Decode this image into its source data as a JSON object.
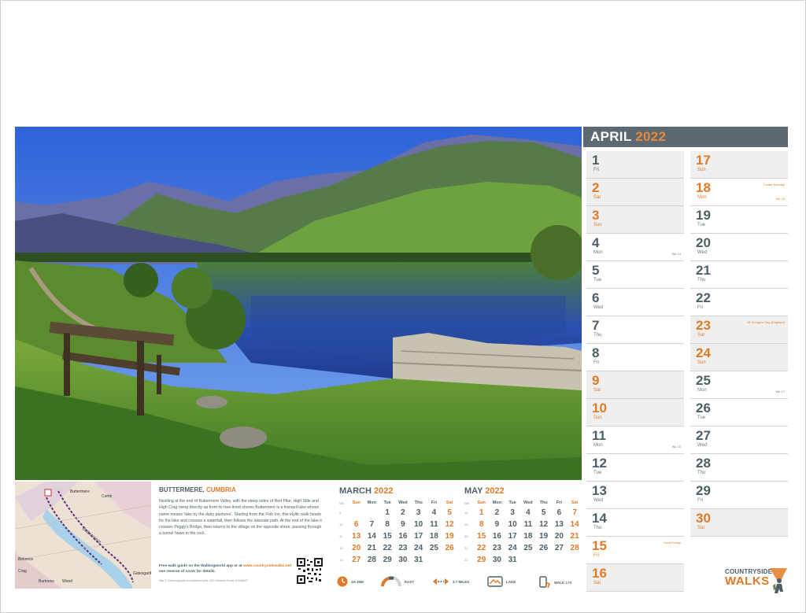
{
  "calendar": {
    "month": "APRIL",
    "year": "2022",
    "left_days": [
      {
        "num": "1",
        "day": "Fri",
        "shaded": true
      },
      {
        "num": "2",
        "day": "Sat",
        "shaded": true,
        "weekend": true
      },
      {
        "num": "3",
        "day": "Sun",
        "shaded": true,
        "weekend": true
      },
      {
        "num": "4",
        "day": "Mon",
        "wk": "Wk 14"
      },
      {
        "num": "5",
        "day": "Tue"
      },
      {
        "num": "6",
        "day": "Wed"
      },
      {
        "num": "7",
        "day": "Thu"
      },
      {
        "num": "8",
        "day": "Fri"
      },
      {
        "num": "9",
        "day": "Sat",
        "shaded": true,
        "weekend": true
      },
      {
        "num": "10",
        "day": "Sun",
        "shaded": true,
        "weekend": true
      },
      {
        "num": "11",
        "day": "Mon",
        "wk": "Wk 15"
      },
      {
        "num": "12",
        "day": "Tue"
      },
      {
        "num": "13",
        "day": "Wed"
      },
      {
        "num": "14",
        "day": "Thu"
      },
      {
        "num": "15",
        "day": "Fri",
        "weekend": true,
        "note": "Good Friday"
      },
      {
        "num": "16",
        "day": "Sat",
        "shaded": true,
        "weekend": true
      }
    ],
    "right_days": [
      {
        "num": "17",
        "day": "Sun",
        "shaded": true,
        "weekend": true
      },
      {
        "num": "18",
        "day": "Mon",
        "weekend": true,
        "note": "Easter Monday",
        "wk": "Wk 16"
      },
      {
        "num": "19",
        "day": "Tue"
      },
      {
        "num": "20",
        "day": "Wed"
      },
      {
        "num": "21",
        "day": "Thu"
      },
      {
        "num": "22",
        "day": "Fri"
      },
      {
        "num": "23",
        "day": "Sat",
        "shaded": true,
        "weekend": true,
        "note": "St George's Day (England)"
      },
      {
        "num": "24",
        "day": "Sun",
        "shaded": true,
        "weekend": true
      },
      {
        "num": "25",
        "day": "Mon",
        "wk": "Wk 17"
      },
      {
        "num": "26",
        "day": "Tue"
      },
      {
        "num": "27",
        "day": "Wed"
      },
      {
        "num": "28",
        "day": "Thu"
      },
      {
        "num": "29",
        "day": "Fri"
      },
      {
        "num": "30",
        "day": "Sat",
        "shaded": true,
        "weekend": true
      }
    ]
  },
  "walk": {
    "title": "BUTTERMERE,",
    "region": "CUMBRIA",
    "description": "Nestling at the end of Buttermere Valley, with the steep sides of Red Pike, High Stile and High Crag rising directly up from its tree-lined shores Buttermere is a tranquil lake whose name means 'lake by the dairy pastures'. Starting from the Fish Inn, this idyllic walk heads for the lake and crosses a waterfall, then follows the lakeside path. At the end of the lake it crosses Peggy's Bridge, then returns to the village on the opposite shore, passing through a tunnel hewn in the rock.",
    "guide_prefix": "Free walk guide on the Walkingworld app or at",
    "guide_link": "www.countrysidewalks.net",
    "guide_suffix": "see reverse of cover for details.",
    "copyright": "Map © Crown copyright and database rights 2020 Ordnance Survey 100054627"
  },
  "map": {
    "labels": [
      "Buttermere",
      "Buttermere",
      "Gatesgarth",
      "Birkness",
      "Comb",
      "Crag",
      "Burtness",
      "Wood"
    ]
  },
  "mini_march": {
    "month": "MARCH",
    "year": "2022",
    "headers": [
      "Sun",
      "Mon",
      "Tue",
      "Wed",
      "Thu",
      "Fri",
      "Sat"
    ],
    "wk_header": "Wk",
    "rows": [
      {
        "wk": "9",
        "days": [
          "",
          "",
          "1",
          "2",
          "3",
          "4",
          "5"
        ]
      },
      {
        "wk": "10",
        "days": [
          "6",
          "7",
          "8",
          "9",
          "10",
          "11",
          "12"
        ]
      },
      {
        "wk": "11",
        "days": [
          "13",
          "14",
          "15",
          "16",
          "17",
          "18",
          "19"
        ]
      },
      {
        "wk": "12",
        "days": [
          "20",
          "21",
          "22",
          "23",
          "24",
          "25",
          "26"
        ]
      },
      {
        "wk": "13",
        "days": [
          "27",
          "28",
          "29",
          "30",
          "31",
          "",
          ""
        ]
      }
    ]
  },
  "mini_may": {
    "month": "MAY",
    "year": "2022",
    "headers": [
      "Sun",
      "Mon",
      "Tue",
      "Wed",
      "Thu",
      "Fri",
      "Sat"
    ],
    "wk_header": "Wk",
    "rows": [
      {
        "wk": "18",
        "days": [
          "1",
          "2",
          "3",
          "4",
          "5",
          "6",
          "7"
        ]
      },
      {
        "wk": "19",
        "days": [
          "8",
          "9",
          "10",
          "11",
          "12",
          "13",
          "14"
        ]
      },
      {
        "wk": "20",
        "days": [
          "15",
          "16",
          "17",
          "18",
          "19",
          "20",
          "21"
        ]
      },
      {
        "wk": "21",
        "days": [
          "22",
          "23",
          "24",
          "25",
          "26",
          "27",
          "28"
        ]
      },
      {
        "wk": "22",
        "days": [
          "29",
          "30",
          "31",
          "",
          "",
          "",
          ""
        ]
      }
    ]
  },
  "stats": {
    "time": "1H 35M",
    "difficulty": "EASY",
    "distance": "3.7 MILES",
    "feature": "LAKE",
    "walk_id": "WALK 173"
  },
  "brand": {
    "line1": "COUNTRYSIDE",
    "line2": "WALKS"
  },
  "colors": {
    "accent": "#e07a26",
    "header": "#5b6a72",
    "text": "#4e5f68"
  }
}
